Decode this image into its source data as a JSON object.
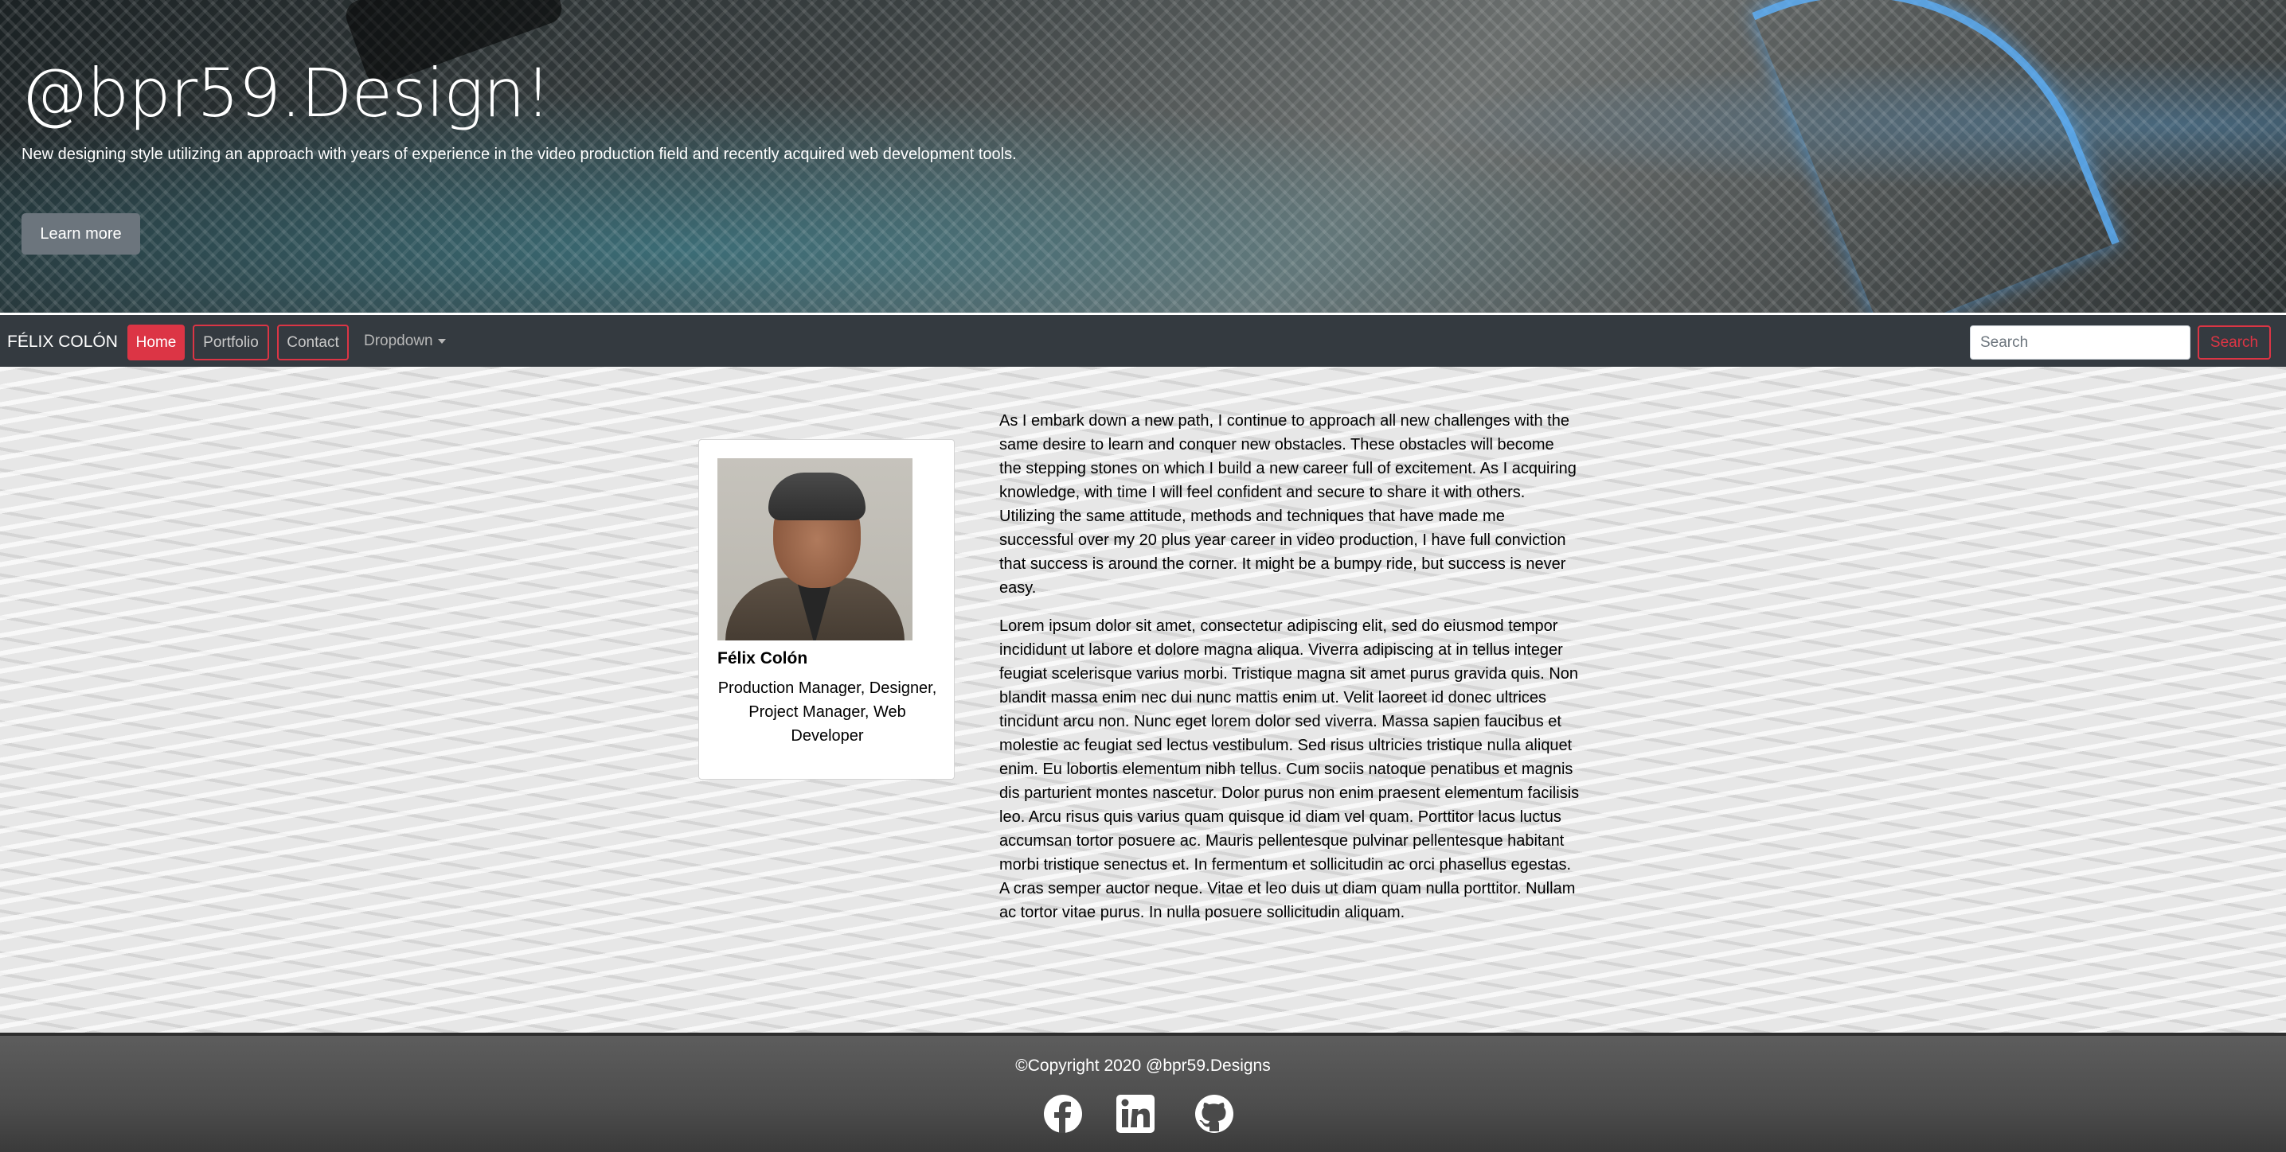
{
  "hero": {
    "title": "@bpr59.Design!",
    "subtitle": "New designing style utilizing an approach with years of experience in the video production field and recently acquired web development tools.",
    "button_label": "Learn more"
  },
  "navbar": {
    "brand": "FÉLIX COLÓN",
    "items": [
      {
        "label": "Home",
        "active": true
      },
      {
        "label": "Portfolio",
        "active": false
      },
      {
        "label": "Contact",
        "active": false
      }
    ],
    "dropdown_label": "Dropdown",
    "search_placeholder": "Search",
    "search_button": "Search",
    "accent_color": "#dc3545"
  },
  "profile": {
    "name": "Félix Colón",
    "roles": "Production Manager, Designer, Project Manager, Web Developer"
  },
  "bio": {
    "paragraphs": [
      "As I embark down a new path, I continue to approach all new challenges with the same desire to learn and conquer new obstacles. These obstacles will become the stepping stones on which I build a new career full of excitement. As I acquiring knowledge, with time I will feel confident and secure to share it with others. Utilizing the same attitude, methods and techniques that have made me successful over my 20 plus year career in video production, I have full conviction that success is around the corner. It might be a bumpy ride, but success is never easy.",
      "Lorem ipsum dolor sit amet, consectetur adipiscing elit, sed do eiusmod tempor incididunt ut labore et dolore magna aliqua. Viverra adipiscing at in tellus integer feugiat scelerisque varius morbi. Tristique magna sit amet purus gravida quis. Non blandit massa enim nec dui nunc mattis enim ut. Velit laoreet id donec ultrices tincidunt arcu non. Nunc eget lorem dolor sed viverra. Massa sapien faucibus et molestie ac feugiat sed lectus vestibulum. Sed risus ultricies tristique nulla aliquet enim. Eu lobortis elementum nibh tellus. Cum sociis natoque penatibus et magnis dis parturient montes nascetur. Dolor purus non enim praesent elementum facilisis leo. Arcu risus quis varius quam quisque id diam vel quam. Porttitor lacus luctus accumsan tortor posuere ac. Mauris pellentesque pulvinar pellentesque habitant morbi tristique senectus et. In fermentum et sollicitudin ac orci phasellus egestas. A cras semper auctor neque. Vitae et leo duis ut diam quam nulla porttitor. Nullam ac tortor vitae purus. In nulla posuere sollicitudin aliquam."
    ]
  },
  "footer": {
    "copyright": "©Copyright 2020 @bpr59.Designs",
    "social_icons": [
      "facebook-icon",
      "linkedin-icon",
      "github-icon"
    ]
  }
}
